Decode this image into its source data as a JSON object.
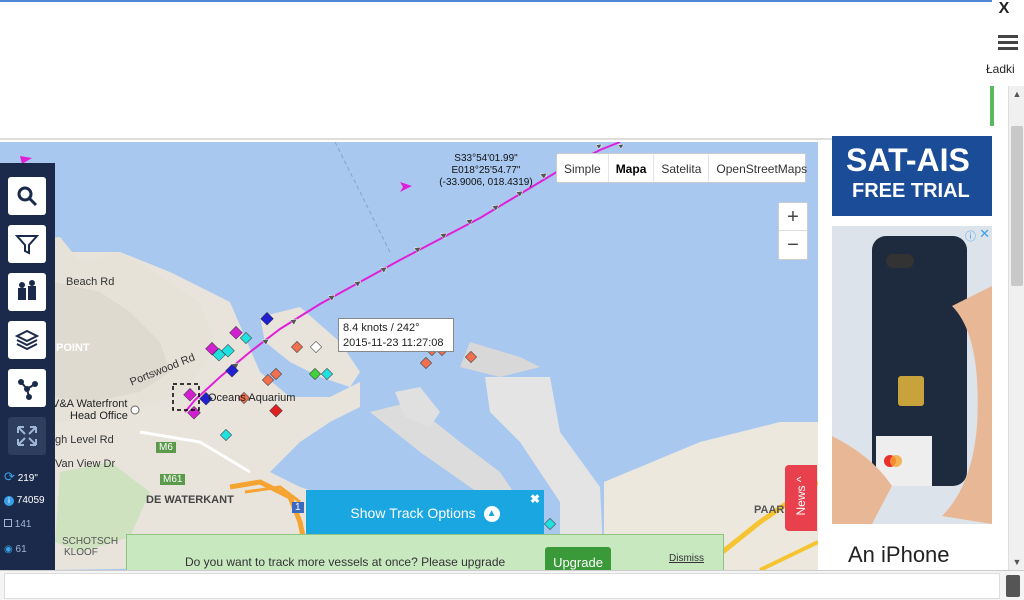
{
  "window": {
    "close_glyph": "X",
    "menu_label": "Ładki"
  },
  "map_types": [
    {
      "label": "Simple",
      "selected": false
    },
    {
      "label": "Mapa",
      "selected": true
    },
    {
      "label": "Satelita",
      "selected": false
    },
    {
      "label": "OpenStreetMaps",
      "selected": false
    }
  ],
  "coords": {
    "line1": "S33°54'01.99\"",
    "line2": "E018°25'54.77\"",
    "line3": "(-33.9006, 018.4319)"
  },
  "tooltip": {
    "speed": "8.4 knots / 242°",
    "time": "2015-11-23 11:27:08"
  },
  "zoom": {
    "in": "+",
    "out": "−"
  },
  "sidebar": {
    "buttons": [
      "search-icon",
      "filter-icon",
      "fleet-icon",
      "layers-icon",
      "network-icon",
      "fullscreen-icon"
    ],
    "stats": [
      {
        "icon": "refresh-icon",
        "value": "219\""
      },
      {
        "icon": "info-icon",
        "value": "74059"
      },
      {
        "icon": "square-icon",
        "value": "141"
      },
      {
        "icon": "eye-icon",
        "value": "61"
      }
    ]
  },
  "map_labels": {
    "beach_rd": "Beach Rd",
    "point": "POINT",
    "portswood": "Portswood Rd",
    "waterfront": "V&A Waterfront",
    "head_office": "Head Office",
    "aquarium": "Oceans Aquarium",
    "high_level": "gh Level Rd",
    "van_view": "Van View Dr",
    "waterkant": "DE WATERKANT",
    "schotsch": "SCHOTSCH",
    "kloof": "KLOOF",
    "paar": "PAAR",
    "m6": "M6",
    "m61": "M61",
    "r1": "1"
  },
  "news": "News ^",
  "track_options": {
    "label": "Show Track Options",
    "close": "✖"
  },
  "upgrade": {
    "message": "Do you want to track more vessels at once? Please upgrade",
    "button": "Upgrade",
    "dismiss": "Dismiss"
  },
  "ads": {
    "sat_title": "SAT-AIS",
    "sat_sub": "FREE TRIAL",
    "iphone_text": "An iPhone"
  },
  "colors": {
    "track": "#e020d8",
    "sidebar": "#1b2a4a",
    "water": "#a8c8f0",
    "land": "#e8e4dc",
    "track_btn": "#1aa6e0"
  }
}
